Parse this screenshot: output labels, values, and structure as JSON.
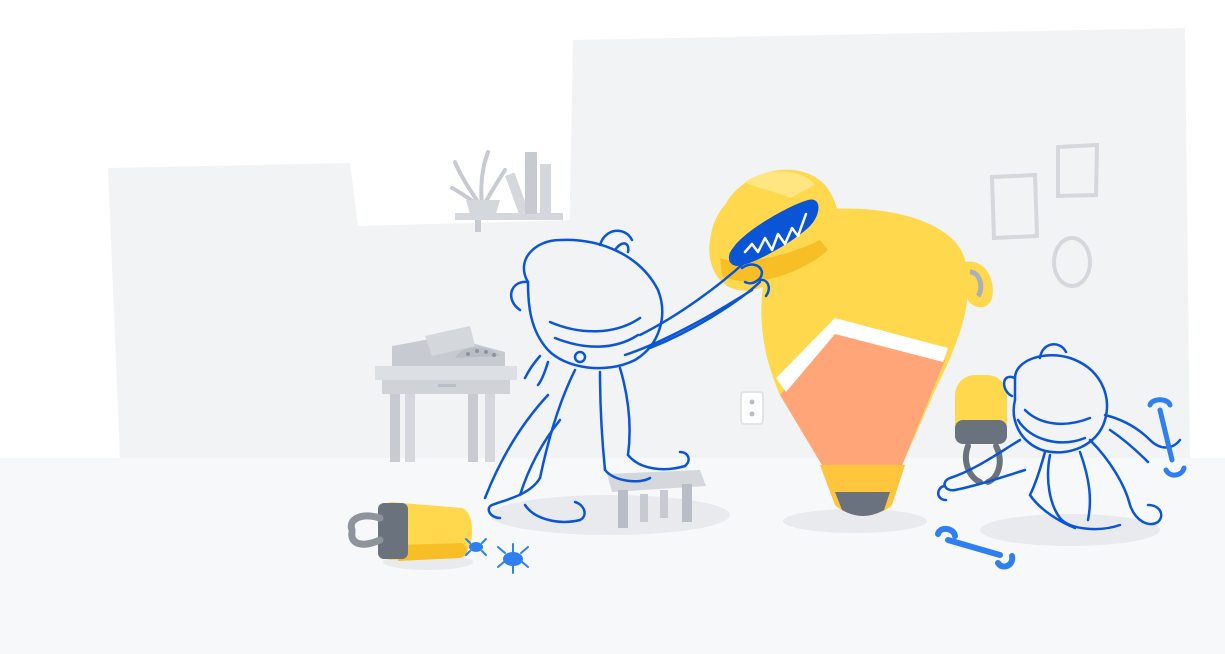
{
  "scene": {
    "colors": {
      "background": "#ffffff",
      "wall": "#f2f3f5",
      "floor": "#f6f8fa",
      "furniture": "#d4d7dc",
      "furniture_dark": "#b9bec6",
      "shadow": "#e4e7eb",
      "outline_blue": "#0a55d6",
      "bright_blue": "#2f7ff0",
      "yellow": "#ffd84d",
      "yellow_light": "#ffe680",
      "yellow_dark": "#f7bf25",
      "orange": "#ffa578",
      "orange_dark": "#ff8f5a",
      "dark_gray": "#6a737d",
      "white": "#ffffff"
    },
    "icons": [
      "octocat-character-left",
      "octocat-character-right",
      "yellow-robot",
      "robot-helmet",
      "wrench-icon",
      "bug-icon",
      "plant-icon",
      "books-icon",
      "picture-frame-icon",
      "power-outlet-icon"
    ]
  }
}
